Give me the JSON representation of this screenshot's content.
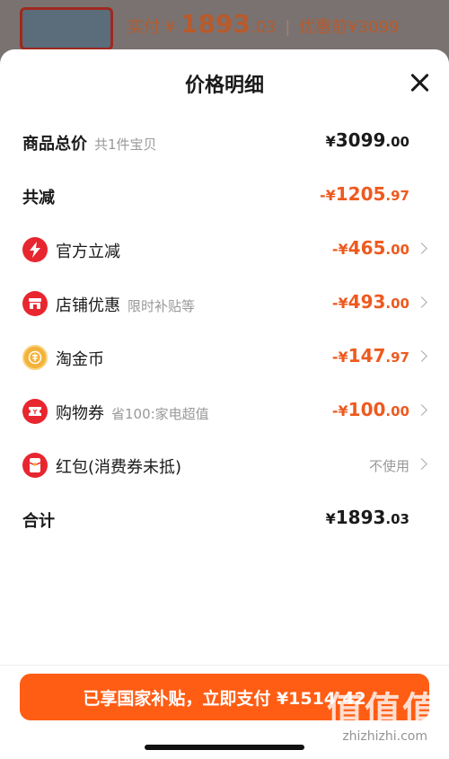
{
  "background": {
    "paid_label": "实付",
    "paid_currency": "¥",
    "paid_int": "1893",
    "paid_dec": ".03",
    "separator": "|",
    "original_label": "优惠前",
    "original_price": "¥3099"
  },
  "sheet": {
    "title": "价格明细",
    "rows": [
      {
        "label": "商品总价",
        "sub": "共1件宝贝",
        "currency": "¥",
        "int": "3099",
        "dec": ".00"
      },
      {
        "label": "共减",
        "currency": "-¥",
        "int": "1205",
        "dec": ".97"
      },
      {
        "label": "官方立减",
        "icon": "lightning-icon",
        "currency": "-¥",
        "int": "465",
        "dec": ".00"
      },
      {
        "label": "店铺优惠",
        "sub": "限时补贴等",
        "icon": "shop-icon",
        "currency": "-¥",
        "int": "493",
        "dec": ".00"
      },
      {
        "label": "淘金币",
        "icon": "coin-icon",
        "currency": "-¥",
        "int": "147",
        "dec": ".97"
      },
      {
        "label": "购物券",
        "sub": "省100:家电超值",
        "icon": "ticket-icon",
        "currency": "-¥",
        "int": "100",
        "dec": ".00"
      },
      {
        "label": "红包(消费券未抵)",
        "icon": "red-packet-icon",
        "status": "不使用"
      },
      {
        "label": "合计",
        "currency": "¥",
        "int": "1893",
        "dec": ".03"
      }
    ]
  },
  "pay_button": {
    "label": "已享国家补贴，立即支付 ¥1514.42"
  },
  "watermark": {
    "big": "值值值",
    "small": "zhizhizhi.com"
  },
  "colors": {
    "accent": "#ff5d14",
    "discount": "#ee5a1f",
    "icon_red": "#e8262f",
    "icon_gold": "#f4b23a"
  }
}
